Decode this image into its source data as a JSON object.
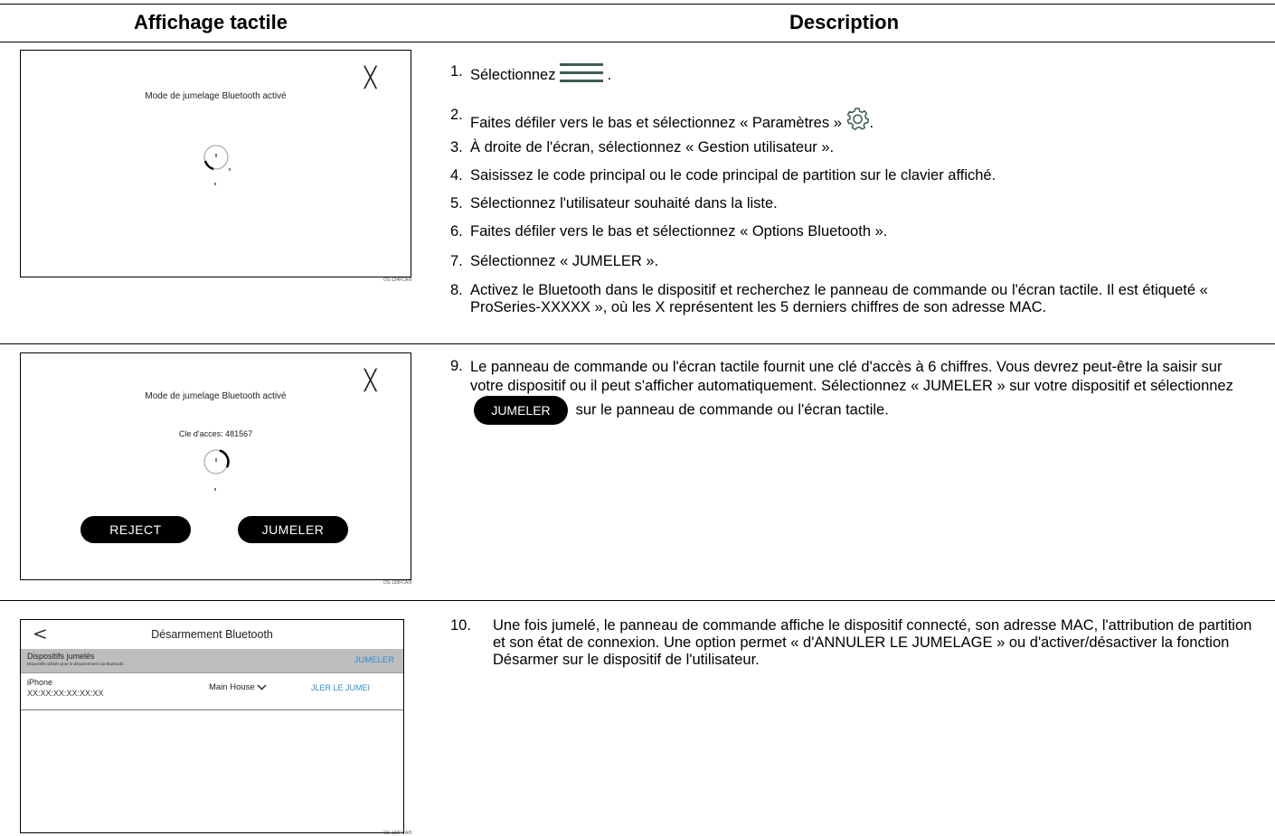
{
  "header": {
    "col1": "Affichage tactile",
    "col2": "Description"
  },
  "screen1": {
    "title": "Mode de jumelage Bluetooth activé",
    "code": "OS-134FCA/0"
  },
  "screen2": {
    "title": "Mode de jumelage Bluetooth activé",
    "passkey": "Cle d'acces: 481567",
    "reject_label": "REJECT",
    "pair_label": "JUMELER",
    "code": "OS-135FCA/0"
  },
  "screen3": {
    "title": "Désarmement Bluetooth",
    "section_title": "Dispositifs jumelés",
    "section_sub": "Dispositifs utilisés pour le désarmement via Bluetooth",
    "pair_link": "JUMELER",
    "device_name": "iPhone",
    "device_mac": "XX:XX:XX:XX:XX:XX",
    "partition": "Main House",
    "unpair_link": "JLER LE JUMEI",
    "code": "OS-133FCA/0"
  },
  "steps": {
    "s1_num": "1.",
    "s1_a": "Sélectionnez",
    "s1_b": ".",
    "s2_num": "2.",
    "s2_a": "Faites défiler vers le bas et sélectionnez « Paramètres »",
    "s2_b": ".",
    "s3_num": "3.",
    "s3": "À droite de l'écran, sélectionnez « Gestion utilisateur ».",
    "s4_num": "4.",
    "s4": "Saisissez le code principal ou le code principal de partition sur le clavier affiché.",
    "s5_num": "5.",
    "s5": "Sélectionnez l'utilisateur souhaité dans la liste.",
    "s6_num": "6.",
    "s6": "Faites défiler vers le bas et sélectionnez « Options Bluetooth ».",
    "s7_num": "7.",
    "s7": "Sélectionnez « JUMELER ».",
    "s8_num": "8.",
    "s8": "Activez le Bluetooth dans le dispositif et recherchez le panneau de commande ou l'écran tactile. Il est étiqueté « ProSeries-XXXXX », où les X représentent les 5 derniers chiffres de son adresse MAC.",
    "s9_num": "9.",
    "s9_a": "Le panneau de commande ou l'écran tactile fournit une clé d'accès à 6 chiffres. Vous devrez peut-être la saisir sur votre dispositif ou il peut s'afficher automatiquement. Sélectionnez « JUMELER » sur votre dispositif et sélectionnez",
    "s9_pill": "JUMELER",
    "s9_b": "sur le panneau de commande ou l'écran tactile.",
    "s10_num": "10.",
    "s10": "Une fois jumelé, le panneau de commande affiche le dispositif connecté, son adresse MAC, l'attribution de partition et son état de connexion. Une option permet « d'ANNULER LE JUMELAGE » ou d'activer/désactiver la fonction Désarmer sur le dispositif de l'utilisateur."
  }
}
